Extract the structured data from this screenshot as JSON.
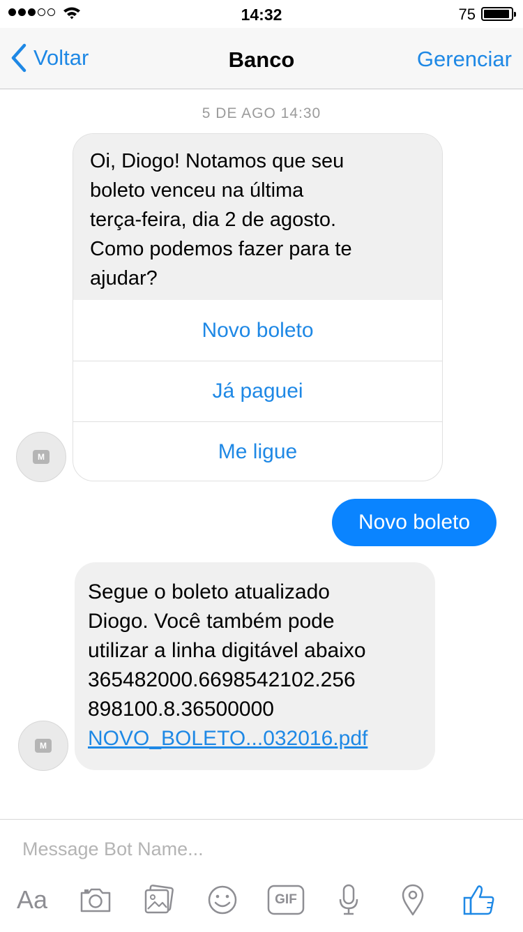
{
  "status_bar": {
    "time": "14:32",
    "battery_percent": "75",
    "signal_bars_filled": 3,
    "signal_bars_total": 5
  },
  "nav": {
    "back_label": "Voltar",
    "title": "Banco",
    "right_action": "Gerenciar"
  },
  "conversation": {
    "timestamp": "5 DE AGO 14:30",
    "bot_card": {
      "text_lines": [
        "Oi, Diogo! Notamos que seu",
        "boleto venceu na última",
        "terça-feira, dia 2 de agosto.",
        "Como podemos fazer para te",
        "ajudar?"
      ],
      "quick_replies": [
        "Novo boleto",
        "Já paguei",
        "Me ligue"
      ]
    },
    "user_message": "Novo boleto",
    "bot_message": {
      "text_lines": [
        "Segue o boleto atualizado",
        "Diogo. Você também pode",
        "utilizar a linha digitável abaixo",
        "365482000.6698542102.256",
        "898100.8.36500000"
      ],
      "attachment": "NOVO_BOLETO...032016.pdf"
    },
    "avatar_letter": "M"
  },
  "composer": {
    "placeholder": "Message Bot Name...",
    "value": "",
    "aa_label": "Aa",
    "gif_label": "GIF",
    "tools": [
      "text-format-icon",
      "camera-icon",
      "photo-gallery-icon",
      "emoji-icon",
      "gif-icon",
      "microphone-icon",
      "location-icon",
      "thumbs-up-icon"
    ]
  },
  "colors": {
    "accent": "#1e88e5",
    "user_bubble": "#0a84ff",
    "bot_bubble": "#f0f0f0",
    "icon_gray": "#8e8e93"
  }
}
